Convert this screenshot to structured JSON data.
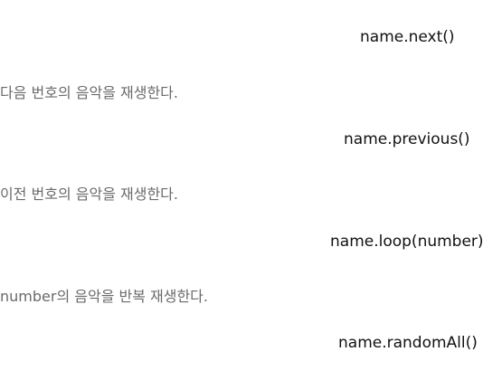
{
  "entries": [
    {
      "method": "name.next()",
      "description": "다음 번호의 음악을 재생한다."
    },
    {
      "method": "name.previous()",
      "description": "이전 번호의 음악을 재생한다."
    },
    {
      "method": "name.loop(number)",
      "description": "number의 음악을 반복 재생한다."
    },
    {
      "method": "name.randomAll()"
    }
  ]
}
